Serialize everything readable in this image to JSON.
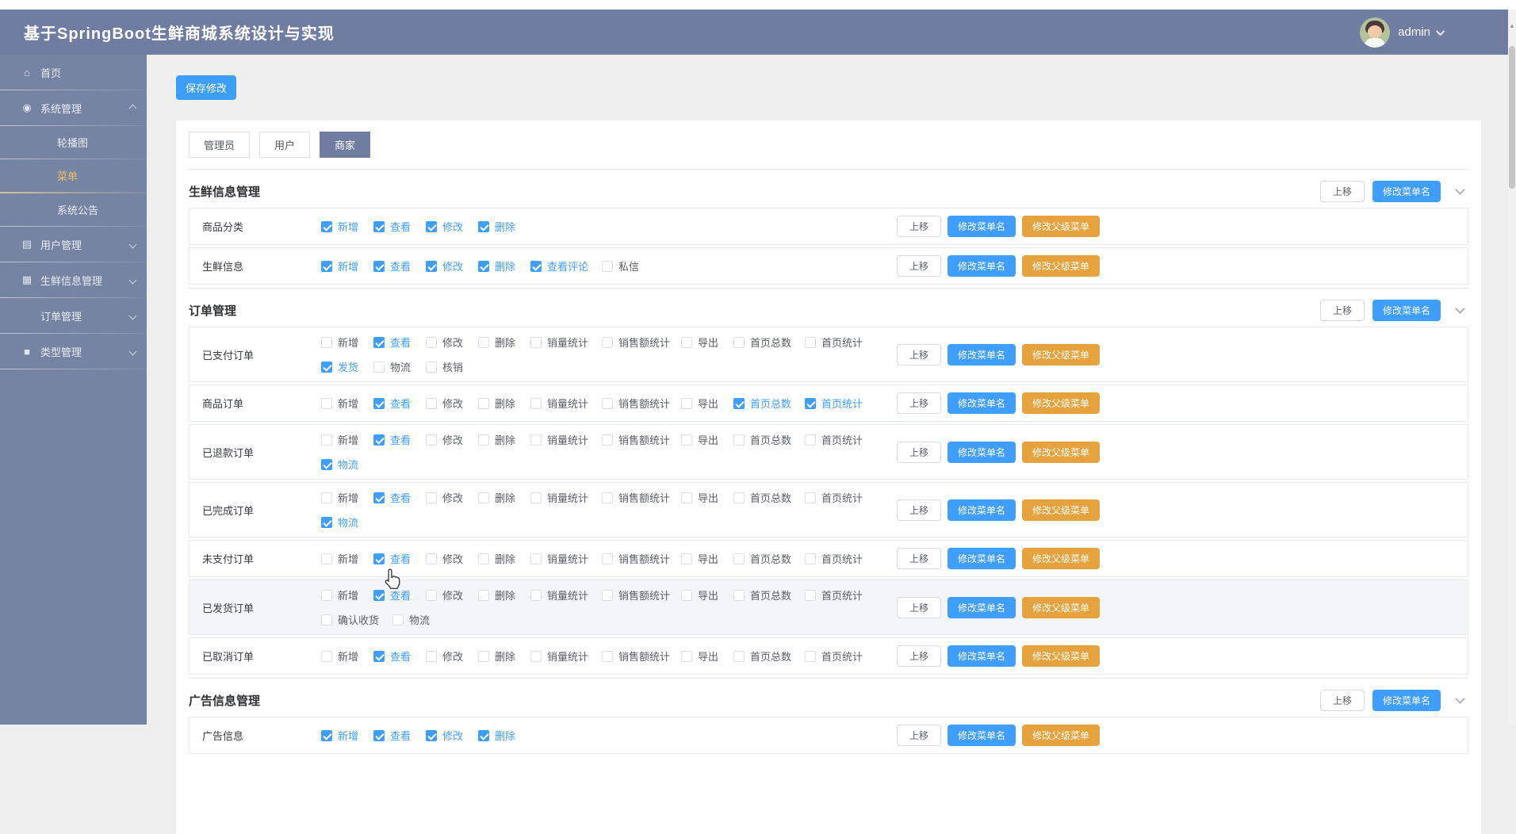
{
  "header": {
    "title": "基于SpringBoot生鲜商城系统设计与实现",
    "username": "admin"
  },
  "sidebar": {
    "items": [
      {
        "label": "首页",
        "icon": "home-icon",
        "group": false
      },
      {
        "label": "系统管理",
        "icon": "gear-icon",
        "group": true,
        "expanded": true,
        "children": [
          {
            "label": "轮播图",
            "active": false
          },
          {
            "label": "菜单",
            "active": true
          },
          {
            "label": "系统公告",
            "active": false
          }
        ]
      },
      {
        "label": "用户管理",
        "icon": "monitor-icon",
        "group": true,
        "expanded": false
      },
      {
        "label": "生鲜信息管理",
        "icon": "grid-icon",
        "group": true,
        "expanded": false
      },
      {
        "label": "订单管理",
        "icon": "",
        "group": true,
        "expanded": false
      },
      {
        "label": "类型管理",
        "icon": "square-icon",
        "group": true,
        "expanded": false
      }
    ]
  },
  "toolbar": {
    "save_label": "保存修改"
  },
  "tabs": [
    {
      "label": "管理员",
      "active": false
    },
    {
      "label": "用户",
      "active": false
    },
    {
      "label": "商家",
      "active": true
    }
  ],
  "buttons": {
    "move_up": "上移",
    "rename_menu": "修改菜单名",
    "change_parent": "修改父级菜单"
  },
  "sections": [
    {
      "title": "生鲜信息管理",
      "rows": [
        {
          "label": "商品分类",
          "hover": false,
          "lines": [
            [
              {
                "t": "新增",
                "c": true
              },
              {
                "t": "查看",
                "c": true
              },
              {
                "t": "修改",
                "c": true
              },
              {
                "t": "删除",
                "c": true
              }
            ]
          ]
        },
        {
          "label": "生鲜信息",
          "hover": false,
          "lines": [
            [
              {
                "t": "新增",
                "c": true
              },
              {
                "t": "查看",
                "c": true
              },
              {
                "t": "修改",
                "c": true
              },
              {
                "t": "删除",
                "c": true
              },
              {
                "t": "查看评论",
                "c": true
              },
              {
                "t": "私信",
                "c": false
              }
            ]
          ]
        }
      ]
    },
    {
      "title": "订单管理",
      "rows": [
        {
          "label": "已支付订单",
          "hover": false,
          "lines": [
            [
              {
                "t": "新增",
                "c": false
              },
              {
                "t": "查看",
                "c": true
              },
              {
                "t": "修改",
                "c": false
              },
              {
                "t": "删除",
                "c": false
              },
              {
                "t": "销量统计",
                "c": false
              },
              {
                "t": "销售额统计",
                "c": false
              },
              {
                "t": "导出",
                "c": false
              },
              {
                "t": "首页总数",
                "c": false
              },
              {
                "t": "首页统计",
                "c": false
              }
            ],
            [
              {
                "t": "发货",
                "c": true
              },
              {
                "t": "物流",
                "c": false
              },
              {
                "t": "核销",
                "c": false
              }
            ]
          ]
        },
        {
          "label": "商品订单",
          "hover": false,
          "lines": [
            [
              {
                "t": "新增",
                "c": false
              },
              {
                "t": "查看",
                "c": true
              },
              {
                "t": "修改",
                "c": false
              },
              {
                "t": "删除",
                "c": false
              },
              {
                "t": "销量统计",
                "c": false
              },
              {
                "t": "销售额统计",
                "c": false
              },
              {
                "t": "导出",
                "c": false
              },
              {
                "t": "首页总数",
                "c": true
              },
              {
                "t": "首页统计",
                "c": true
              }
            ]
          ]
        },
        {
          "label": "已退款订单",
          "hover": false,
          "lines": [
            [
              {
                "t": "新增",
                "c": false
              },
              {
                "t": "查看",
                "c": true
              },
              {
                "t": "修改",
                "c": false
              },
              {
                "t": "删除",
                "c": false
              },
              {
                "t": "销量统计",
                "c": false
              },
              {
                "t": "销售额统计",
                "c": false
              },
              {
                "t": "导出",
                "c": false
              },
              {
                "t": "首页总数",
                "c": false
              },
              {
                "t": "首页统计",
                "c": false
              }
            ],
            [
              {
                "t": "物流",
                "c": true
              }
            ]
          ]
        },
        {
          "label": "已完成订单",
          "hover": false,
          "lines": [
            [
              {
                "t": "新增",
                "c": false
              },
              {
                "t": "查看",
                "c": true
              },
              {
                "t": "修改",
                "c": false
              },
              {
                "t": "删除",
                "c": false
              },
              {
                "t": "销量统计",
                "c": false
              },
              {
                "t": "销售额统计",
                "c": false
              },
              {
                "t": "导出",
                "c": false
              },
              {
                "t": "首页总数",
                "c": false
              },
              {
                "t": "首页统计",
                "c": false
              }
            ],
            [
              {
                "t": "物流",
                "c": true
              }
            ]
          ]
        },
        {
          "label": "未支付订单",
          "hover": false,
          "lines": [
            [
              {
                "t": "新增",
                "c": false
              },
              {
                "t": "查看",
                "c": true
              },
              {
                "t": "修改",
                "c": false
              },
              {
                "t": "删除",
                "c": false
              },
              {
                "t": "销量统计",
                "c": false
              },
              {
                "t": "销售额统计",
                "c": false
              },
              {
                "t": "导出",
                "c": false
              },
              {
                "t": "首页总数",
                "c": false
              },
              {
                "t": "首页统计",
                "c": false
              }
            ]
          ]
        },
        {
          "label": "已发货订单",
          "hover": true,
          "lines": [
            [
              {
                "t": "新增",
                "c": false
              },
              {
                "t": "查看",
                "c": true
              },
              {
                "t": "修改",
                "c": false
              },
              {
                "t": "删除",
                "c": false
              },
              {
                "t": "销量统计",
                "c": false
              },
              {
                "t": "销售额统计",
                "c": false
              },
              {
                "t": "导出",
                "c": false
              },
              {
                "t": "首页总数",
                "c": false
              },
              {
                "t": "首页统计",
                "c": false
              }
            ],
            [
              {
                "t": "确认收货",
                "c": false
              },
              {
                "t": "物流",
                "c": false
              }
            ]
          ]
        },
        {
          "label": "已取消订单",
          "hover": false,
          "lines": [
            [
              {
                "t": "新增",
                "c": false
              },
              {
                "t": "查看",
                "c": true
              },
              {
                "t": "修改",
                "c": false
              },
              {
                "t": "删除",
                "c": false
              },
              {
                "t": "销量统计",
                "c": false
              },
              {
                "t": "销售额统计",
                "c": false
              },
              {
                "t": "导出",
                "c": false
              },
              {
                "t": "首页总数",
                "c": false
              },
              {
                "t": "首页统计",
                "c": false
              }
            ]
          ]
        }
      ]
    },
    {
      "title": "广告信息管理",
      "rows": [
        {
          "label": "广告信息",
          "hover": false,
          "lines": [
            [
              {
                "t": "新增",
                "c": true
              },
              {
                "t": "查看",
                "c": true
              },
              {
                "t": "修改",
                "c": true
              },
              {
                "t": "删除",
                "c": true
              }
            ]
          ]
        }
      ]
    }
  ],
  "colors": {
    "accent": "#409eff",
    "warning": "#e6a23c",
    "header_bg": "#6f7da0",
    "sidebar_bg": "#7584a3",
    "active_menu": "#f2c063",
    "page_bg": "#efefef"
  }
}
